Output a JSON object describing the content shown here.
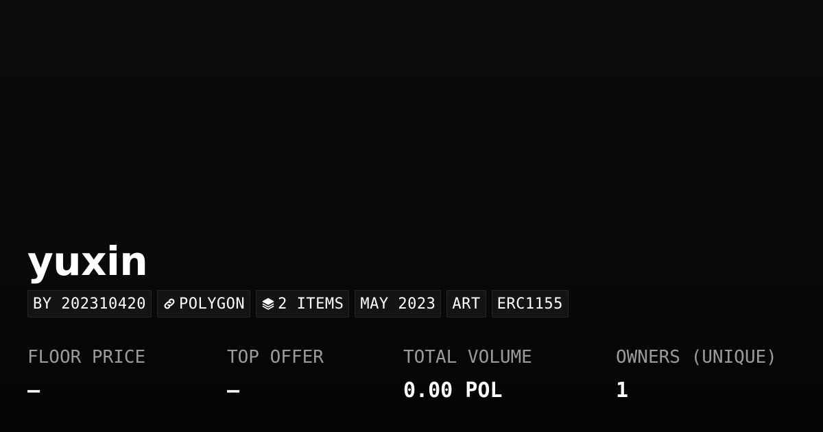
{
  "collection": {
    "name": "yuxin"
  },
  "tags": [
    {
      "label": "BY 202310420",
      "icon": ""
    },
    {
      "label": "POLYGON",
      "icon": "chain-link-icon"
    },
    {
      "label": "2 ITEMS",
      "icon": "layers-icon"
    },
    {
      "label": "MAY 2023",
      "icon": ""
    },
    {
      "label": "ART",
      "icon": ""
    },
    {
      "label": "ERC1155",
      "icon": ""
    }
  ],
  "stats": [
    {
      "label": "FLOOR PRICE",
      "value": "–"
    },
    {
      "label": "TOP OFFER",
      "value": "–"
    },
    {
      "label": "TOTAL VOLUME",
      "value": "0.00 POL"
    },
    {
      "label": "OWNERS (UNIQUE)",
      "value": "1"
    }
  ],
  "colors": {
    "background": "#0a0a0a",
    "text": "#ffffff",
    "muted": "#9b9b9b",
    "tag_background": "#141414",
    "tag_border": "#262626"
  }
}
